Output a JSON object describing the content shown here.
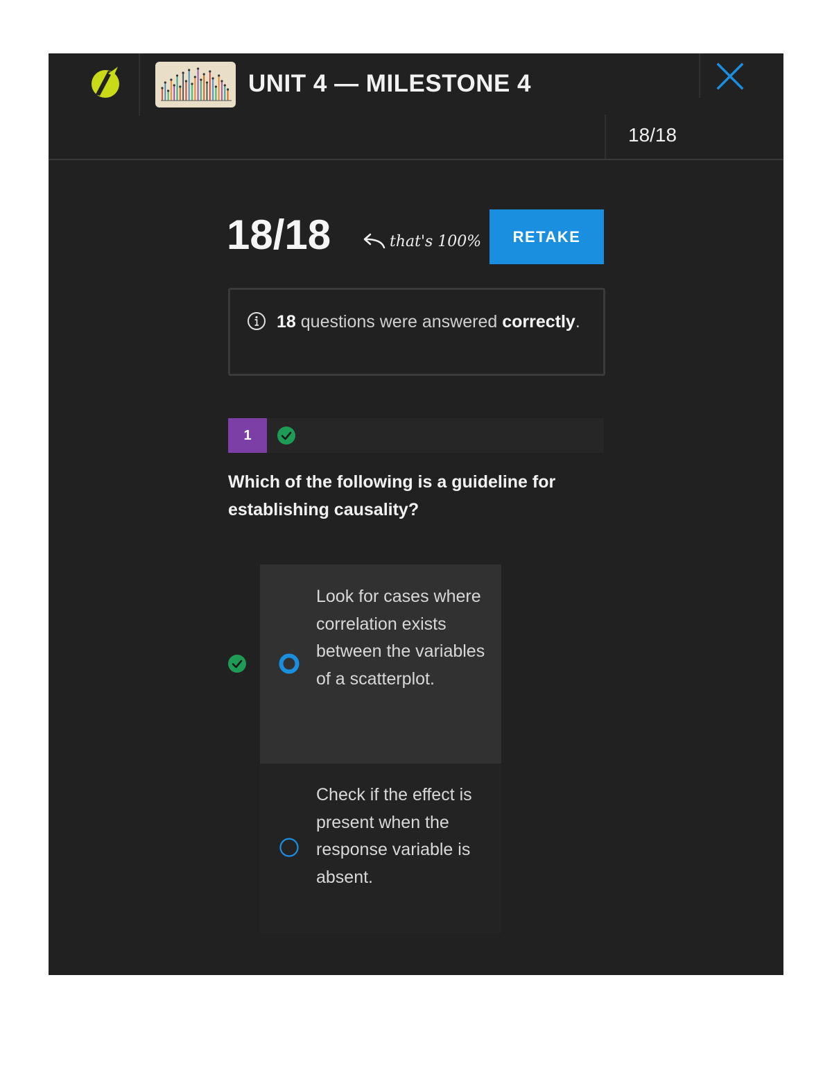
{
  "header": {
    "title": "UNIT 4 — MILESTONE 4",
    "progress": "18/18",
    "logo_icon": "sophia-logo-icon",
    "close_icon": "close-icon",
    "thumbnail_icon": "bar-chart-thumbnail-icon"
  },
  "result": {
    "score": "18/18",
    "note": "that's 100%",
    "note_icon": "curved-arrow-left-icon",
    "retake_label": "RETAKE"
  },
  "info": {
    "icon": "info-icon",
    "count": "18",
    "text_middle": "questions were answered",
    "text_bold": "correctly",
    "text_end": "."
  },
  "question": {
    "number": "1",
    "status_icon": "correct-check-icon",
    "text": "Which of the following is a guideline for establishing causality?",
    "options": [
      {
        "text": "Look for cases where correlation exists between the variables of a scatterplot.",
        "selected": true,
        "correct": true
      },
      {
        "text": "Check if the effect is present when the response variable is absent.",
        "selected": false,
        "correct": false
      }
    ]
  },
  "colors": {
    "panel_bg": "#212121",
    "accent_blue": "#1a8fdf",
    "logo_yellow": "#c8da18",
    "question_number_purple": "#7b3fa6",
    "correct_green": "#1e9b55"
  }
}
